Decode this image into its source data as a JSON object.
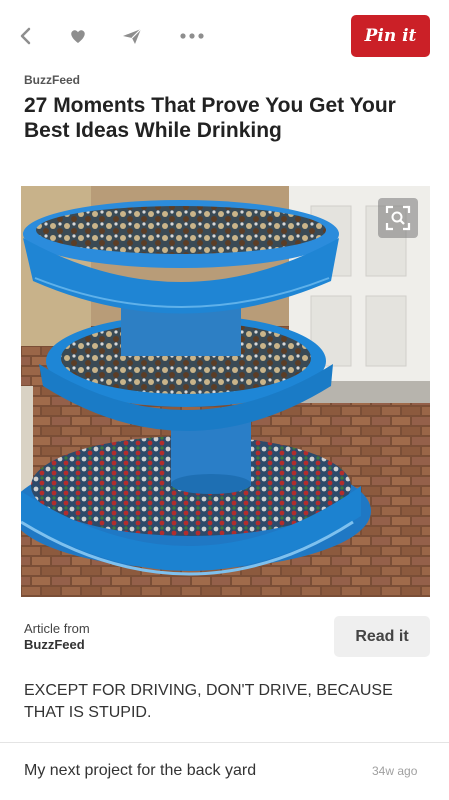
{
  "nav": {
    "back_icon": "chevron-left-icon",
    "like_icon": "heart-icon",
    "send_icon": "send-icon",
    "more_icon": "more-dots-icon",
    "pin_label": "Pin it",
    "pin_color": "#cb2027"
  },
  "pin": {
    "source": "BuzzFeed",
    "title": "27 Moments That Prove You Get Your Best Ideas While Drinking"
  },
  "photo": {
    "zoom_icon": "zoom-icon"
  },
  "article": {
    "label": "Article from",
    "source": "BuzzFeed",
    "read_label": "Read it"
  },
  "description": "EXCEPT FOR DRIVING, DON'T DRIVE, BECAUSE THAT IS STUPID.",
  "comment": {
    "text": "My next project for the back yard",
    "time": "34w ago"
  }
}
